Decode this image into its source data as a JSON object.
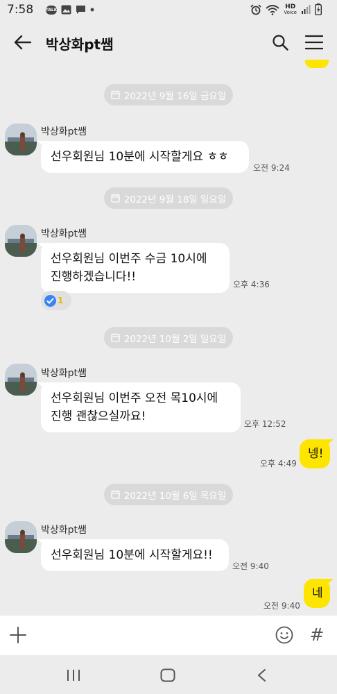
{
  "status_bar": {
    "time": "7:58",
    "talk_badge": "TALK",
    "network": "HD",
    "network_sub": "Voice"
  },
  "header": {
    "title": "박상화pt쌤"
  },
  "messages": {
    "day1": {
      "date": "2022년 9월 16일 금요일",
      "sender": "박상화pt쌤",
      "text": "선우회원님 10분에 시작할게요 ㅎㅎ",
      "time": "오전 9:24"
    },
    "day2": {
      "date": "2022년 9월 18일 일요일",
      "sender": "박상화pt쌤",
      "line1": "선우회원님 이번주 수금 10시에",
      "line2": "진행하겠습니다!!",
      "time": "오후 4:36",
      "reaction_count": "1"
    },
    "day3": {
      "date": "2022년 10월 2일 일요일",
      "sender": "박상화pt쌤",
      "line1": "선우회원님 이번주 오전 목10시에",
      "line2": "진행 괜찮으실까요!",
      "time": "오후 12:52",
      "reply": "넹!",
      "reply_time": "오후 4:49"
    },
    "day4": {
      "date": "2022년 10월 6일 목요일",
      "sender": "박상화pt쌤",
      "text": "선우회원님 10분에 시작할게요!!",
      "time": "오전 9:40",
      "reply": "네",
      "reply_time": "오전 9:40"
    }
  },
  "input_bar": {
    "hash_symbol": "#"
  },
  "colors": {
    "chat_background": "#ececec",
    "my_bubble": "#fee500",
    "their_bubble": "#ffffff",
    "date_pill": "#d9d9d9"
  }
}
